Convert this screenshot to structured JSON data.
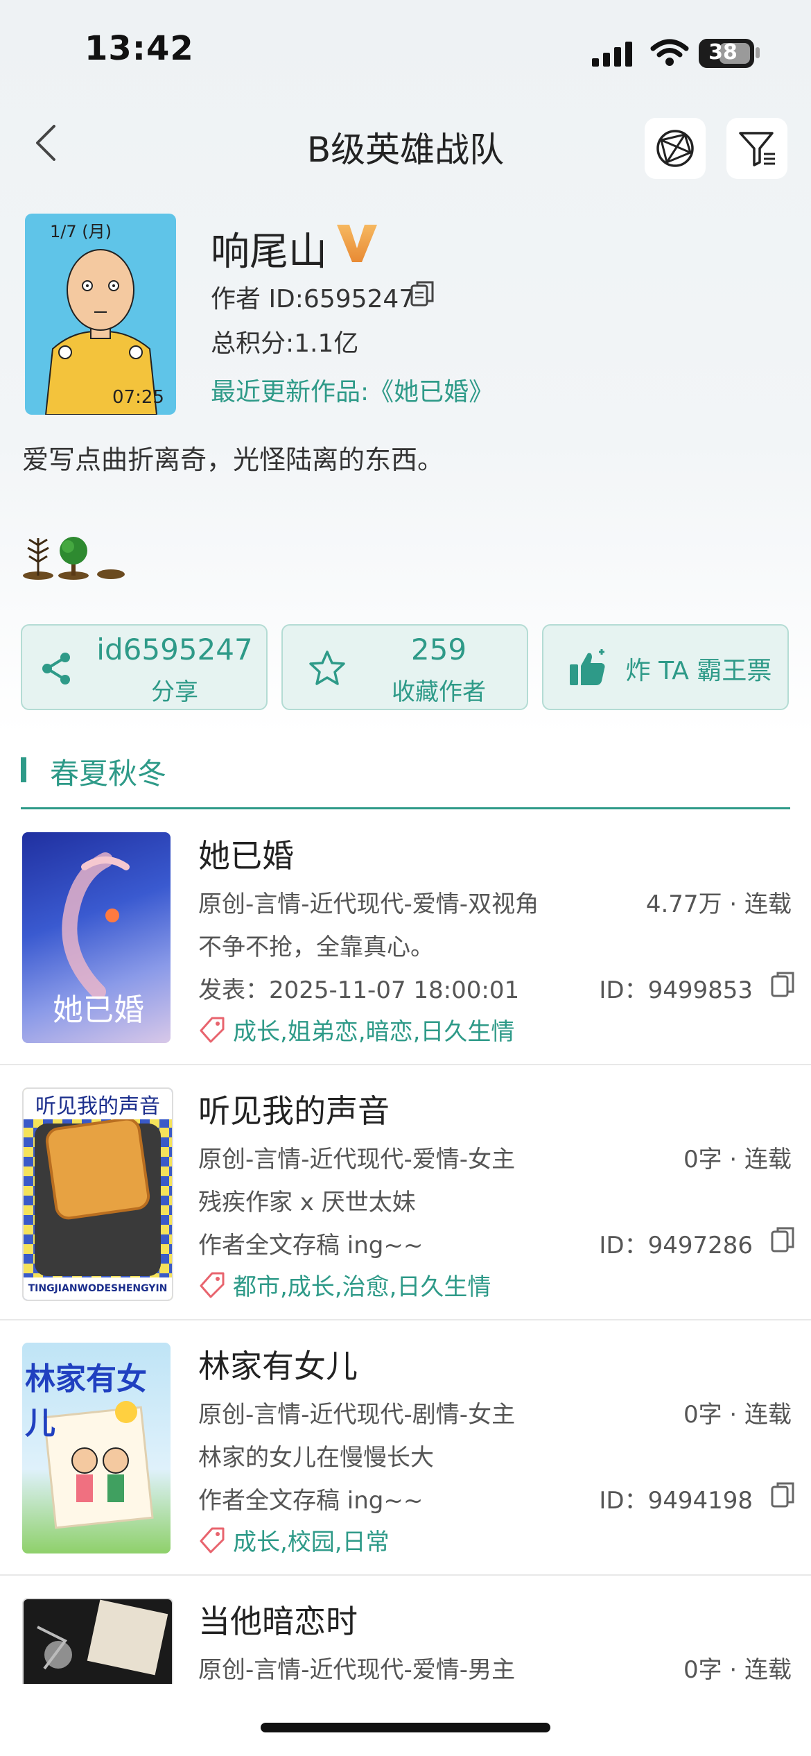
{
  "status_bar": {
    "time": "13:42",
    "battery": "38"
  },
  "nav": {
    "title": "B级英雄战队",
    "icons": [
      "back-icon",
      "globe-icon",
      "filter-icon"
    ]
  },
  "profile": {
    "name": "响尾山",
    "author_id": "作者 ID:6595247",
    "total_score": "总积分:1.1亿",
    "recent_work": "最近更新作品:《她已婚》",
    "bio": "爱写点曲折离奇，光怪陆离的东西。",
    "avatar_date": "1/7 (月)",
    "avatar_time": "07:25"
  },
  "stats": {
    "share": {
      "value": "id6595247",
      "label": "分享"
    },
    "favorite": {
      "value": "259",
      "label": "收藏作者"
    },
    "vote": {
      "label": "炸 TA 霸王票"
    }
  },
  "section": {
    "title": "春夏秋冬"
  },
  "colors": {
    "accent": "#2e9a88",
    "badge": "#f0a04a"
  },
  "books": [
    {
      "title": "她已婚",
      "meta": "原创-言情-近代现代-爱情-双视角",
      "stats": "4.77万 · 连载",
      "desc": "不争不抢，全靠真心。",
      "date": "发表：2025-11-07 18:00:01",
      "id": "ID：9499853",
      "tags": "成长,姐弟恋,暗恋,日久生情",
      "cover_title": "她已婚"
    },
    {
      "title": "听见我的声音",
      "meta": "原创-言情-近代现代-爱情-女主",
      "stats": "0字 · 连载",
      "desc": "残疾作家 x 厌世太妹",
      "date": "作者全文存稿 ing~~",
      "id": "ID：9497286",
      "tags": "都市,成长,治愈,日久生情",
      "cover_title": "听见我的声音",
      "cover_sub": "TINGJIANWODESHENGYIN"
    },
    {
      "title": "林家有女儿",
      "meta": "原创-言情-近代现代-剧情-女主",
      "stats": "0字 · 连载",
      "desc": "林家的女儿在慢慢长大",
      "date": "作者全文存稿 ing~~",
      "id": "ID：9494198",
      "tags": "成长,校园,日常",
      "cover_title": "林家有女儿"
    },
    {
      "title": "当他暗恋时",
      "meta": "原创-言情-近代现代-爱情-男主",
      "stats": "0字 · 连载"
    }
  ]
}
